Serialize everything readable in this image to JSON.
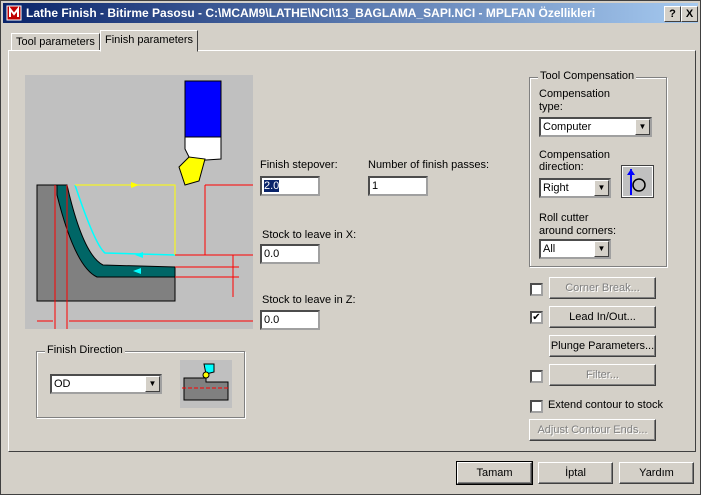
{
  "window": {
    "title": "Lathe Finish - Bitirme Pasosu - C:\\MCAM9\\LATHE\\NCI\\13_BAGLAMA_SAPI.NCI - MPLFAN Özellikleri",
    "help_btn": "?",
    "close_btn": "X"
  },
  "tabs": [
    {
      "label": "Tool parameters"
    },
    {
      "label": "Finish parameters"
    }
  ],
  "finish": {
    "stepover_label": "Finish stepover:",
    "stepover_value": "2.0",
    "passes_label": "Number of finish passes:",
    "passes_value": "1",
    "stock_x_label": "Stock to leave in X:",
    "stock_x_value": "0.0",
    "stock_z_label": "Stock to leave in Z:",
    "stock_z_value": "0.0"
  },
  "finish_direction": {
    "title": "Finish Direction",
    "value": "OD"
  },
  "tool_comp": {
    "title": "Tool Compensation",
    "type_label_1": "Compensation",
    "type_label_2": "type:",
    "type_value": "Computer",
    "dir_label_1": "Compensation",
    "dir_label_2": "direction:",
    "dir_value": "Right",
    "roll_label_1": "Roll cutter",
    "roll_label_2": "around corners:",
    "roll_value": "All"
  },
  "options": {
    "corner_break": "Corner Break...",
    "lead_in_out": "Lead In/Out...",
    "lead_checked": "✔",
    "plunge": "Plunge Parameters...",
    "filter": "Filter...",
    "extend": "Extend contour to stock",
    "adjust": "Adjust Contour Ends..."
  },
  "footer": {
    "ok": "Tamam",
    "cancel": "İptal",
    "help": "Yardım"
  },
  "colors": {
    "titlebar_start": "#0a246a",
    "titlebar_end": "#a6caf0",
    "dialog": "#d4d0c8",
    "diagram_bg": "#c0c0c0",
    "tool_blue": "#0000ff",
    "part_teal": "#006666",
    "guide_red": "#ff0000",
    "path_cyan": "#00ffff",
    "path_yellow": "#ffff00"
  }
}
